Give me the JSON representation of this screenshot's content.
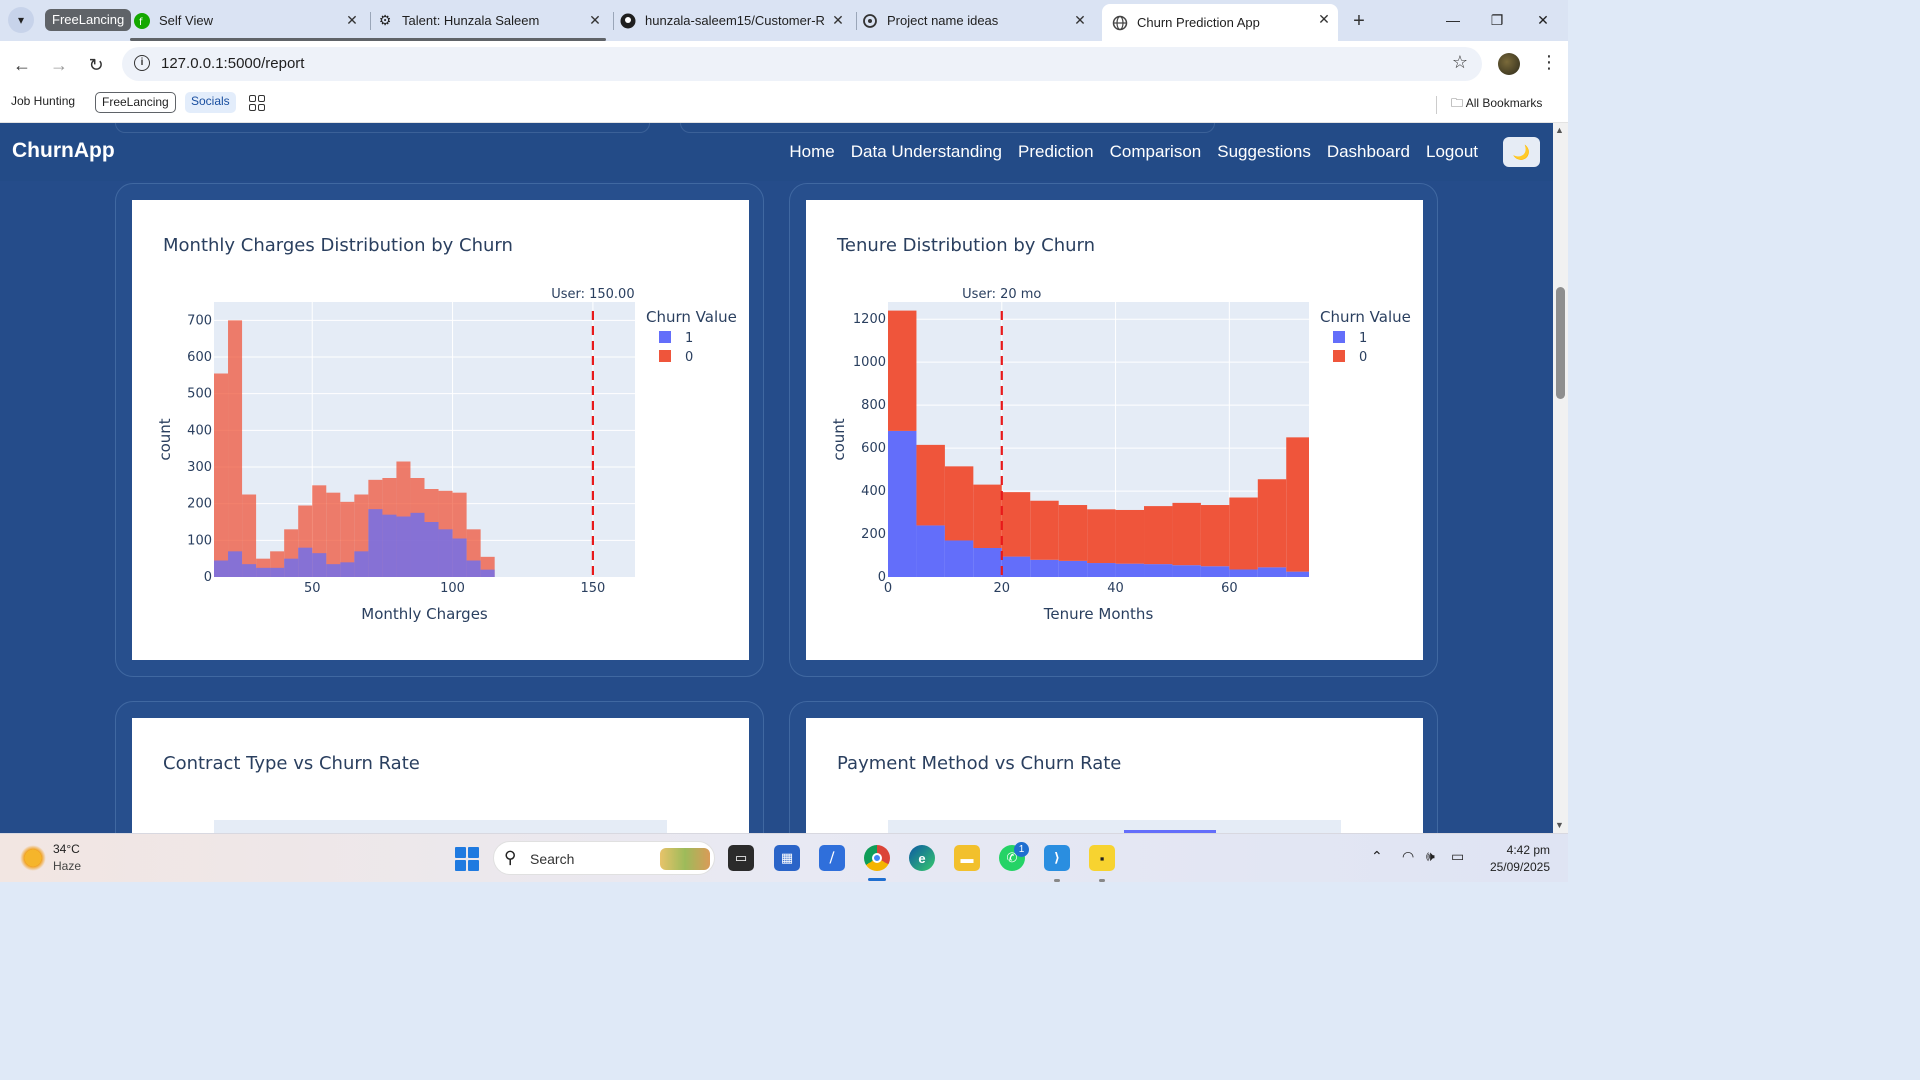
{
  "browser": {
    "group_chip": "FreeLancing",
    "tabs": [
      {
        "title": "Self View",
        "icon": "freelance-icon"
      },
      {
        "title": "Talent: Hunzala Saleem",
        "icon": "gear-icon"
      },
      {
        "title": "hunzala-saleem15/Customer-Re",
        "icon": "github-icon"
      },
      {
        "title": "Project name ideas",
        "icon": "openai-icon"
      },
      {
        "title": "Churn Prediction App",
        "icon": "globe-icon",
        "active": true
      }
    ],
    "url": "127.0.0.1:5000/report",
    "bookmarks": [
      "Job Hunting",
      "FreeLancing",
      "Socials"
    ],
    "all_bookmarks": "All Bookmarks"
  },
  "app": {
    "brand": "ChurnApp",
    "nav": [
      "Home",
      "Data Understanding",
      "Prediction",
      "Comparison",
      "Suggestions",
      "Dashboard",
      "Logout"
    ],
    "theme_icon": "🌙"
  },
  "charts": {
    "monthly": {
      "title": "Monthly Charges Distribution by Churn",
      "xlabel": "Monthly Charges",
      "ylabel": "count",
      "annotation": "User: 150.00",
      "legend_title": "Churn Value",
      "legend": [
        "1",
        "0"
      ]
    },
    "tenure": {
      "title": "Tenure Distribution by Churn",
      "xlabel": "Tenure Months",
      "ylabel": "count",
      "annotation": "User: 20 mo",
      "legend_title": "Churn Value",
      "legend": [
        "1",
        "0"
      ]
    },
    "contract": {
      "title": "Contract Type vs Churn Rate"
    },
    "payment": {
      "title": "Payment Method vs Churn Rate"
    }
  },
  "chart_data": [
    {
      "type": "bar",
      "title": "Monthly Charges Distribution by Churn",
      "xlabel": "Monthly Charges",
      "ylabel": "count",
      "barmode": "overlay",
      "bin_start": 15,
      "bin_width": 5,
      "xlim": [
        15,
        165
      ],
      "ylim": [
        0,
        750
      ],
      "x_ticks": [
        50,
        100,
        150
      ],
      "y_ticks": [
        0,
        100,
        200,
        300,
        400,
        500,
        600,
        700
      ],
      "reference_line": {
        "x": 150,
        "label": "User: 150.00"
      },
      "colors": {
        "1": "#636efa",
        "0": "#ef553b"
      },
      "series": [
        {
          "name": "0",
          "values": [
            555,
            700,
            225,
            50,
            70,
            130,
            195,
            250,
            230,
            205,
            225,
            265,
            270,
            315,
            270,
            240,
            235,
            230,
            130,
            55,
            0
          ]
        },
        {
          "name": "1",
          "values": [
            45,
            70,
            35,
            25,
            25,
            50,
            80,
            65,
            35,
            40,
            70,
            185,
            170,
            165,
            175,
            150,
            130,
            105,
            45,
            20,
            0
          ]
        }
      ]
    },
    {
      "type": "bar",
      "title": "Tenure Distribution by Churn",
      "xlabel": "Tenure Months",
      "ylabel": "count",
      "barmode": "stack",
      "bin_start": 0,
      "bin_width": 5,
      "xlim": [
        0,
        74
      ],
      "ylim": [
        0,
        1280
      ],
      "x_ticks": [
        0,
        20,
        40,
        60
      ],
      "y_ticks": [
        0,
        200,
        400,
        600,
        800,
        1000,
        1200
      ],
      "reference_line": {
        "x": 20,
        "label": "User: 20 mo"
      },
      "colors": {
        "1": "#636efa",
        "0": "#ef553b"
      },
      "series": [
        {
          "name": "1",
          "values": [
            680,
            240,
            170,
            135,
            95,
            80,
            75,
            65,
            62,
            60,
            55,
            50,
            35,
            45,
            25
          ]
        },
        {
          "name": "0",
          "values": [
            560,
            375,
            345,
            295,
            300,
            275,
            260,
            250,
            250,
            270,
            290,
            285,
            335,
            410,
            625
          ]
        }
      ]
    }
  ],
  "taskbar": {
    "temperature": "34°C",
    "condition": "Haze",
    "search": "Search",
    "time": "4:42 pm",
    "date": "25/09/2025",
    "whatsapp_badge": "1"
  }
}
